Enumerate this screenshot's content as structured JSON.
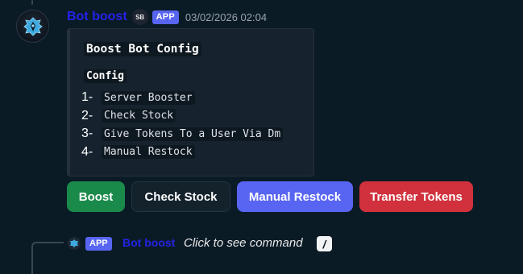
{
  "message": {
    "author": "Bot boost",
    "badge_text": "SB",
    "app_tag": "APP",
    "timestamp": "03/02/2026 02:04"
  },
  "embed": {
    "title": "Boost Bot Config",
    "subtitle": "Config",
    "items": [
      {
        "num": "1-",
        "text": "Server Booster"
      },
      {
        "num": "2-",
        "text": "Check Stock"
      },
      {
        "num": "3-",
        "text": "Give Tokens To a User Via Dm"
      },
      {
        "num": "4-",
        "text": "Manual Restock"
      }
    ]
  },
  "buttons": [
    {
      "label": "Boost",
      "color": "#1a8a4a"
    },
    {
      "label": "Check Stock",
      "color": "#14222b"
    },
    {
      "label": "Manual Restock",
      "color": "#5865f2"
    },
    {
      "label": "Transfer Tokens",
      "color": "#d0313c"
    }
  ],
  "reply": {
    "app_tag": "APP",
    "author": "Bot boost",
    "text": "Click to see command",
    "icon": "slash-command-icon"
  }
}
